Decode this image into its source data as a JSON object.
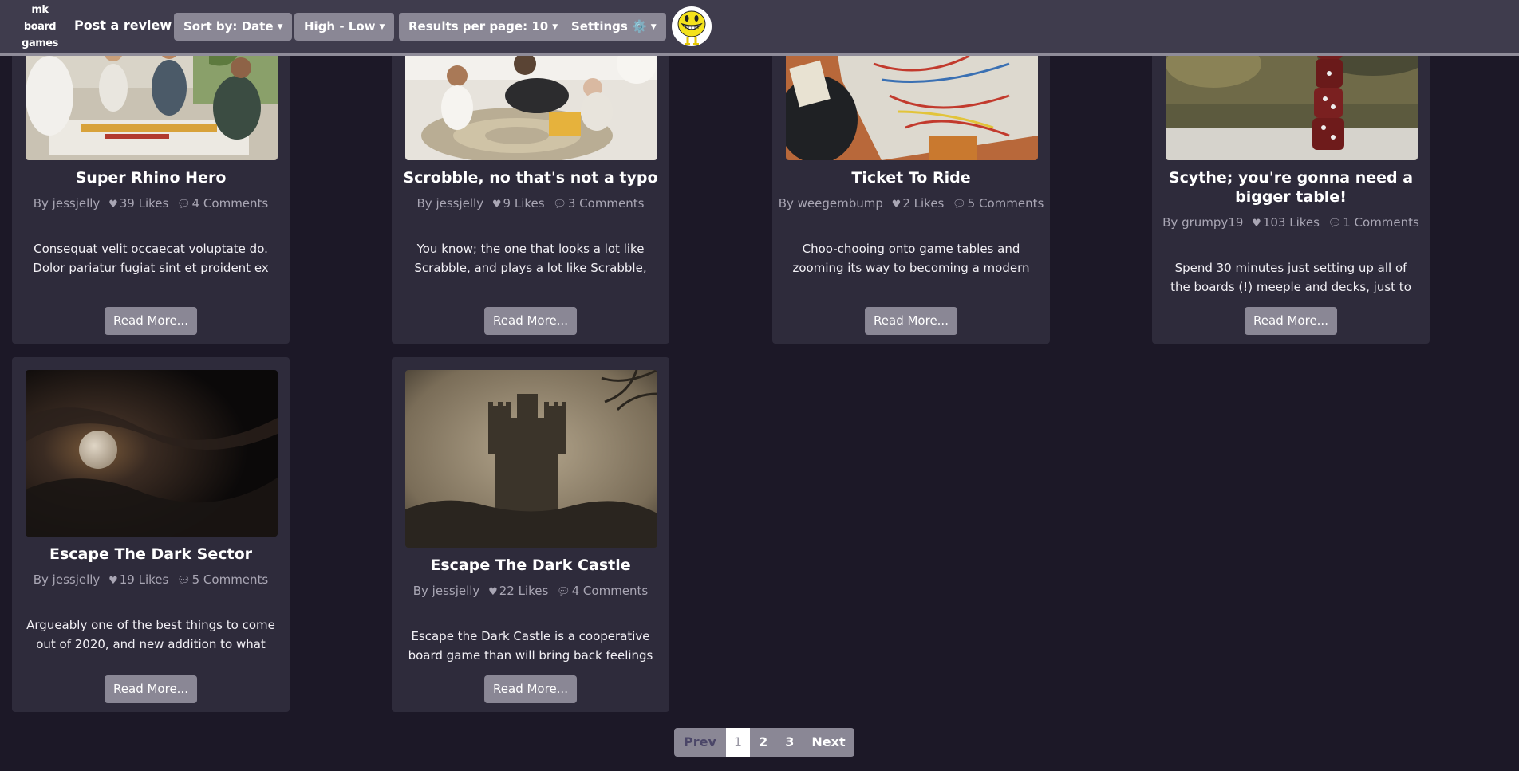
{
  "nav": {
    "brand": [
      "mk",
      "board",
      "games"
    ],
    "post_review": "Post a review",
    "sort_by": "Sort by: Date",
    "order": "High - Low",
    "results_per_page": "Results per page: 10",
    "settings": "Settings ⚙️",
    "avatar_icon": "smiley-face-icon"
  },
  "colors": {
    "page_bg": "#1c1827",
    "navbar_bg": "#3f3c4d",
    "card_bg": "#2e2b3b",
    "button_bg": "#8a8795",
    "muted_text": "#a9a6b4"
  },
  "cards": [
    {
      "title": "Super Rhino Hero",
      "author": "By jessjelly",
      "likes": "39 Likes",
      "comments": "4 Comments",
      "excerpt": "Consequat velit occaecat voluptate do. Dolor pariatur fugiat sint et proident ex do",
      "button": "Read More..."
    },
    {
      "title": "Scrobble, no that's not a typo",
      "author": "By jessjelly",
      "likes": "9 Likes",
      "comments": "3 Comments",
      "excerpt": "You know; the one that looks a lot like Scrabble, and plays a lot like Scrabble, but",
      "button": "Read More..."
    },
    {
      "title": "Ticket To Ride",
      "author": "By weegembump",
      "likes": "2 Likes",
      "comments": "5 Comments",
      "excerpt": "Choo-chooing onto game tables and zooming its way to becoming a modern",
      "button": "Read More..."
    },
    {
      "title": "Scythe; you're gonna need a bigger table!",
      "author": "By grumpy19",
      "likes": "103 Likes",
      "comments": "1 Comments",
      "excerpt": "Spend 30 minutes just setting up all of the boards (!) meeple and decks, just to forget",
      "button": "Read More..."
    },
    {
      "title": "Escape The Dark Sector",
      "author": "By jessjelly",
      "likes": "19 Likes",
      "comments": "5 Comments",
      "excerpt": "Argueably one of the best things to come out of 2020, and new addition to what will",
      "button": "Read More..."
    },
    {
      "title": "Escape The Dark Castle",
      "author": "By jessjelly",
      "likes": "22 Likes",
      "comments": "4 Comments",
      "excerpt": "Escape the Dark Castle is a cooperative board game than will bring back feelings of",
      "button": "Read More..."
    }
  ],
  "pagination": {
    "prev": "Prev",
    "pages": [
      "1",
      "2",
      "3"
    ],
    "current": "1",
    "next": "Next"
  }
}
